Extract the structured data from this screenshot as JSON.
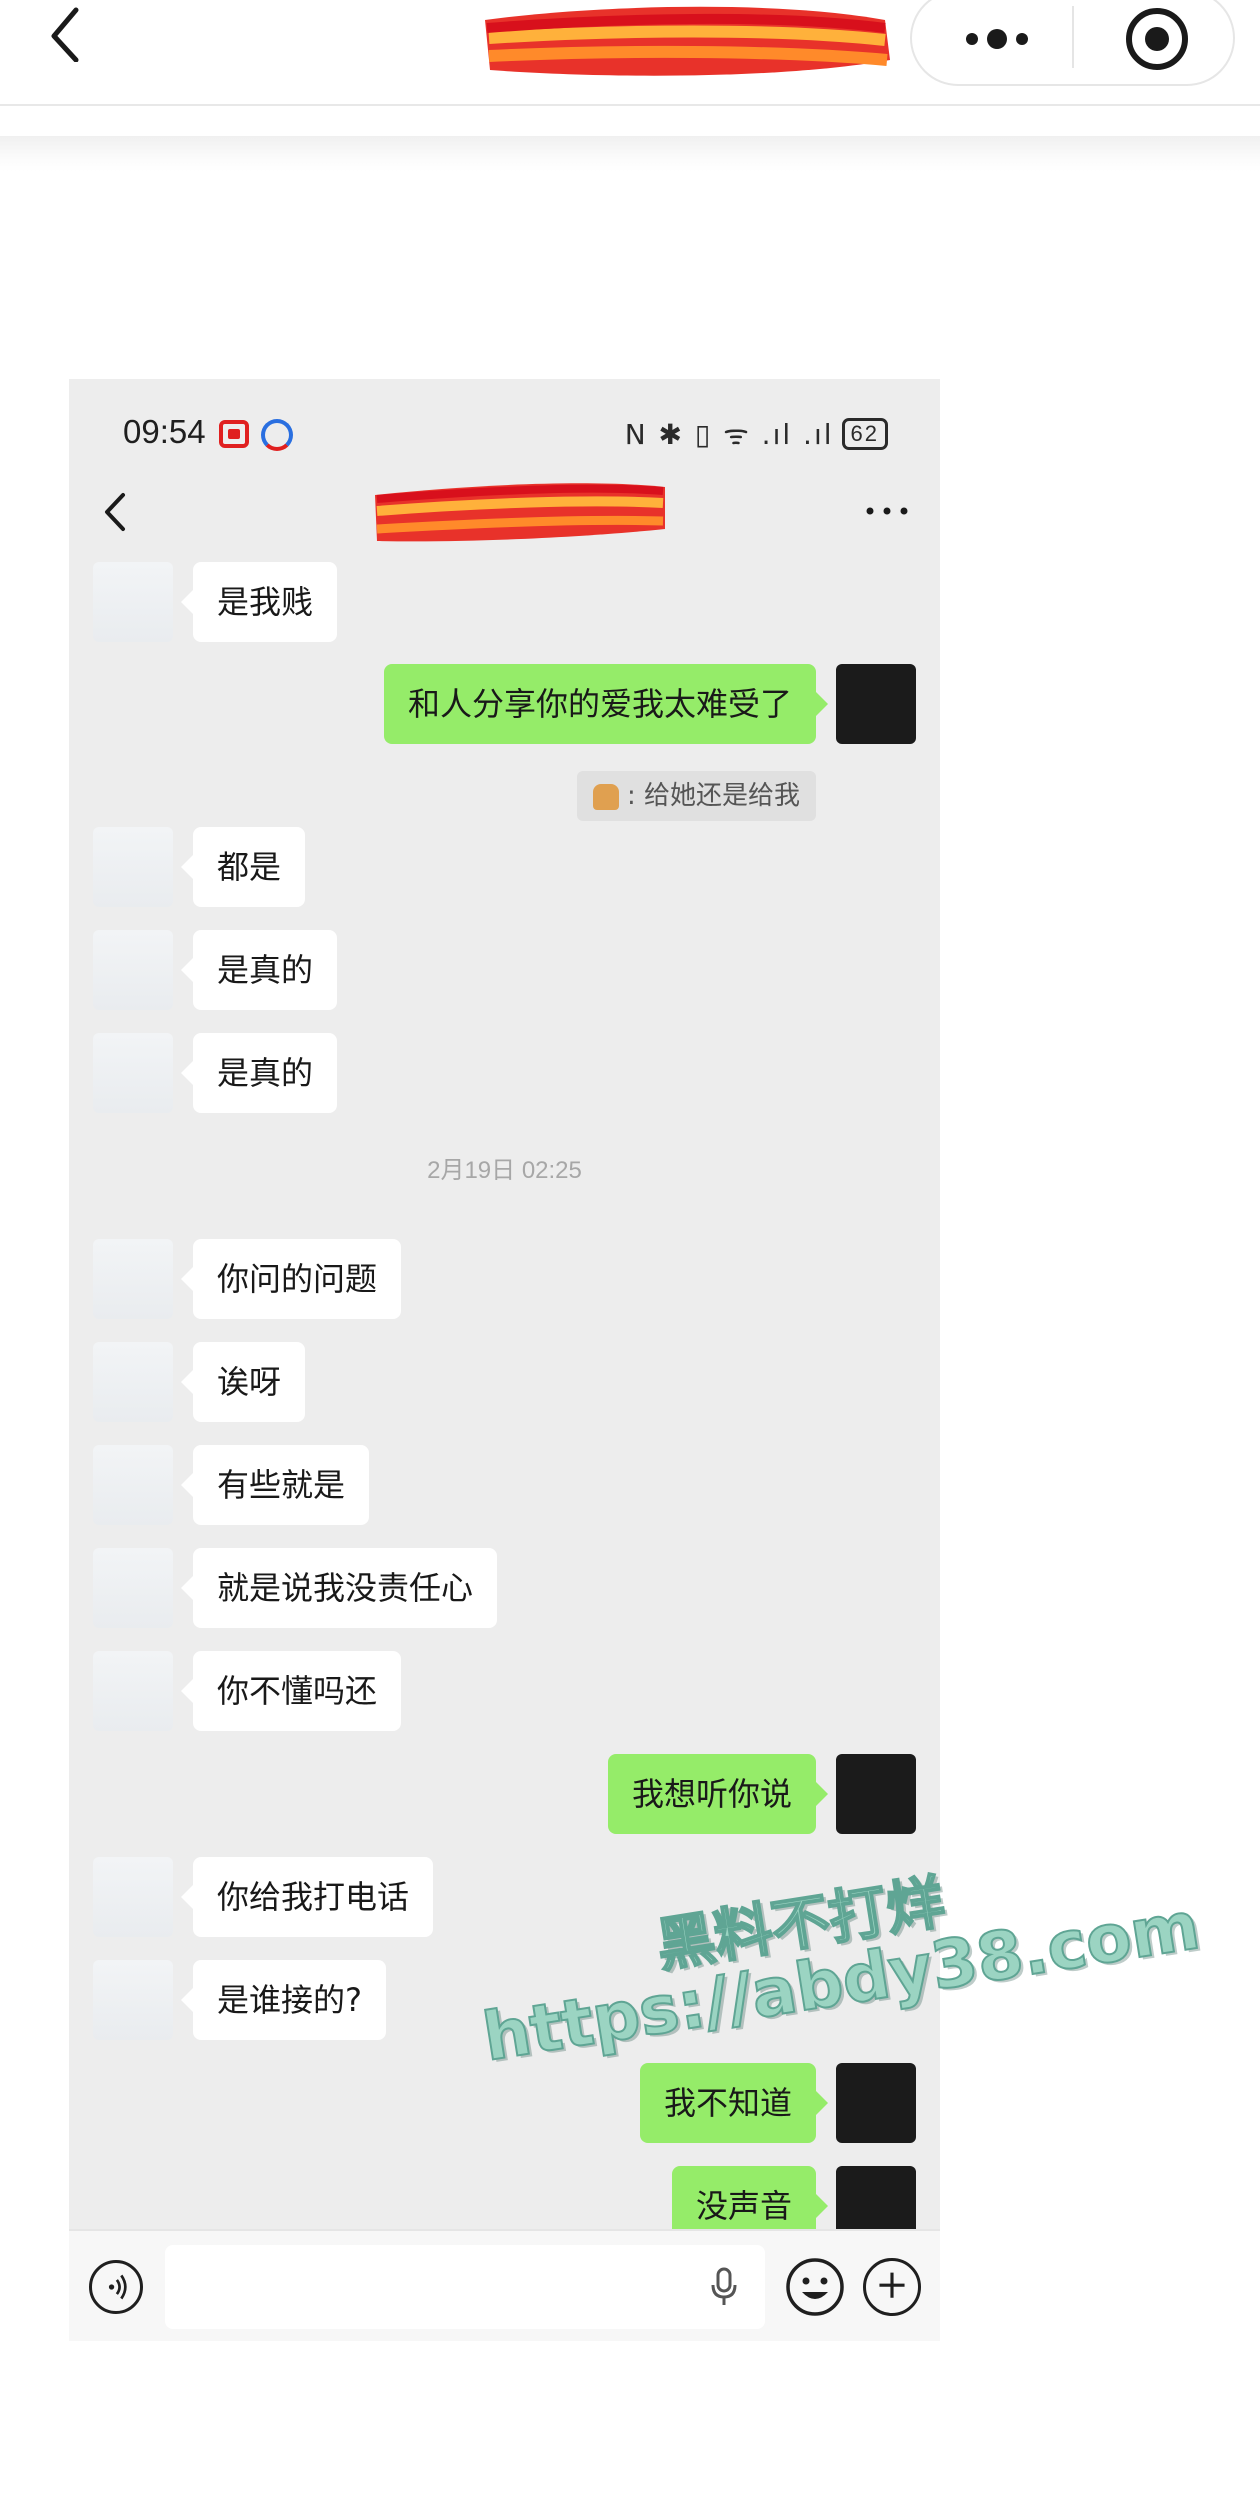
{
  "browser": {
    "capsule_more_icon": "more-dots-icon",
    "capsule_target_icon": "target-icon"
  },
  "phone": {
    "status": {
      "time": "09:54",
      "icons": "N ✱ ▯ ᯤ .ıl .ıl",
      "battery": "62"
    },
    "chat": {
      "title_redacted": true
    },
    "quote": {
      "text": ":  给她还是给我"
    },
    "timestamp": "2月19日 02:25",
    "messages": [
      {
        "side": "left",
        "text": "是我贱"
      },
      {
        "side": "right",
        "text": "和人分享你的爱我太难受了"
      },
      {
        "side": "left",
        "text": "都是"
      },
      {
        "side": "left",
        "text": "是真的"
      },
      {
        "side": "left",
        "text": "是真的"
      },
      {
        "side": "left",
        "text": "你问的问题"
      },
      {
        "side": "left",
        "text": "诶呀"
      },
      {
        "side": "left",
        "text": "有些就是"
      },
      {
        "side": "left",
        "text": "就是说我没责任心"
      },
      {
        "side": "left",
        "text": "你不懂吗还"
      },
      {
        "side": "right",
        "text": "我想听你说"
      },
      {
        "side": "left",
        "text": "你给我打电话"
      },
      {
        "side": "left",
        "text": "是谁接的?"
      },
      {
        "side": "right",
        "text": "我不知道"
      },
      {
        "side": "right",
        "text": "没声音"
      }
    ]
  },
  "watermark": {
    "line1": "黑料不打烊",
    "line2": "https://abdy38.com"
  }
}
